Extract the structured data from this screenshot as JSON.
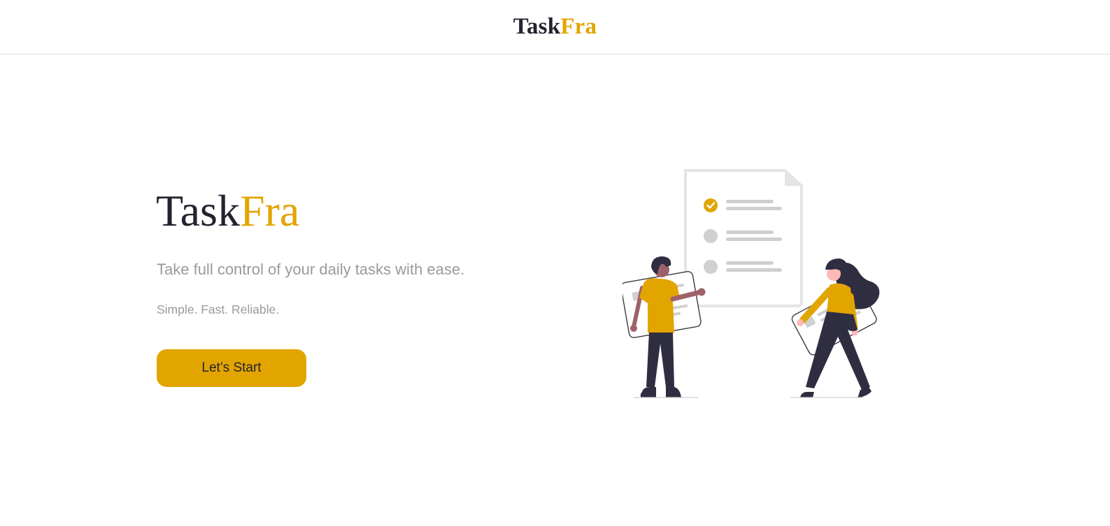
{
  "navbar": {
    "brand_main": "Task",
    "brand_accent": "Fra"
  },
  "hero": {
    "title_main": "Task",
    "title_accent": "Fra",
    "tagline": "Take full control of your daily tasks with ease.",
    "subtitle": "Simple. Fast. Reliable.",
    "cta_label": "Let’s Start"
  },
  "colors": {
    "accent": "#e2a500",
    "dark": "#23232f",
    "muted": "#9a9a9a",
    "divider": "#dddddd"
  },
  "illustration": {
    "checklist_items": [
      {
        "done": true
      },
      {
        "done": false
      },
      {
        "done": false
      }
    ]
  }
}
